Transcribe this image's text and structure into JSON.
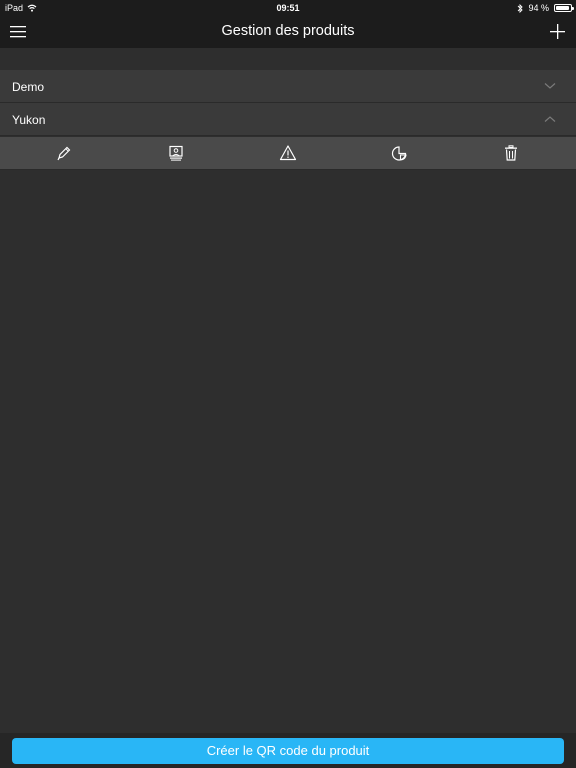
{
  "status_bar": {
    "device": "iPad",
    "time": "09:51",
    "battery": "94 %",
    "battery_level": 0.94,
    "icons": [
      "wifi-icon",
      "bluetooth-icon",
      "battery-icon"
    ]
  },
  "nav": {
    "title": "Gestion des produits",
    "left_icon": "hamburger-menu-icon",
    "right_icon": "plus-icon"
  },
  "products": [
    {
      "label": "Demo",
      "expanded": false
    },
    {
      "label": "Yukon",
      "expanded": true
    }
  ],
  "toolbar": {
    "tools": [
      "pencil-icon",
      "monitor-icon",
      "warning-icon",
      "chart-icon",
      "trash-icon"
    ]
  },
  "cta": {
    "label": "Créer le QR code du produit",
    "color": "#29b6f6"
  },
  "colors": {
    "background": "#2e2e2e",
    "bar": "#1c1c1c",
    "row": "#3a3a3a",
    "toolbar": "#4a4a4a",
    "accent": "#29b6f6"
  }
}
